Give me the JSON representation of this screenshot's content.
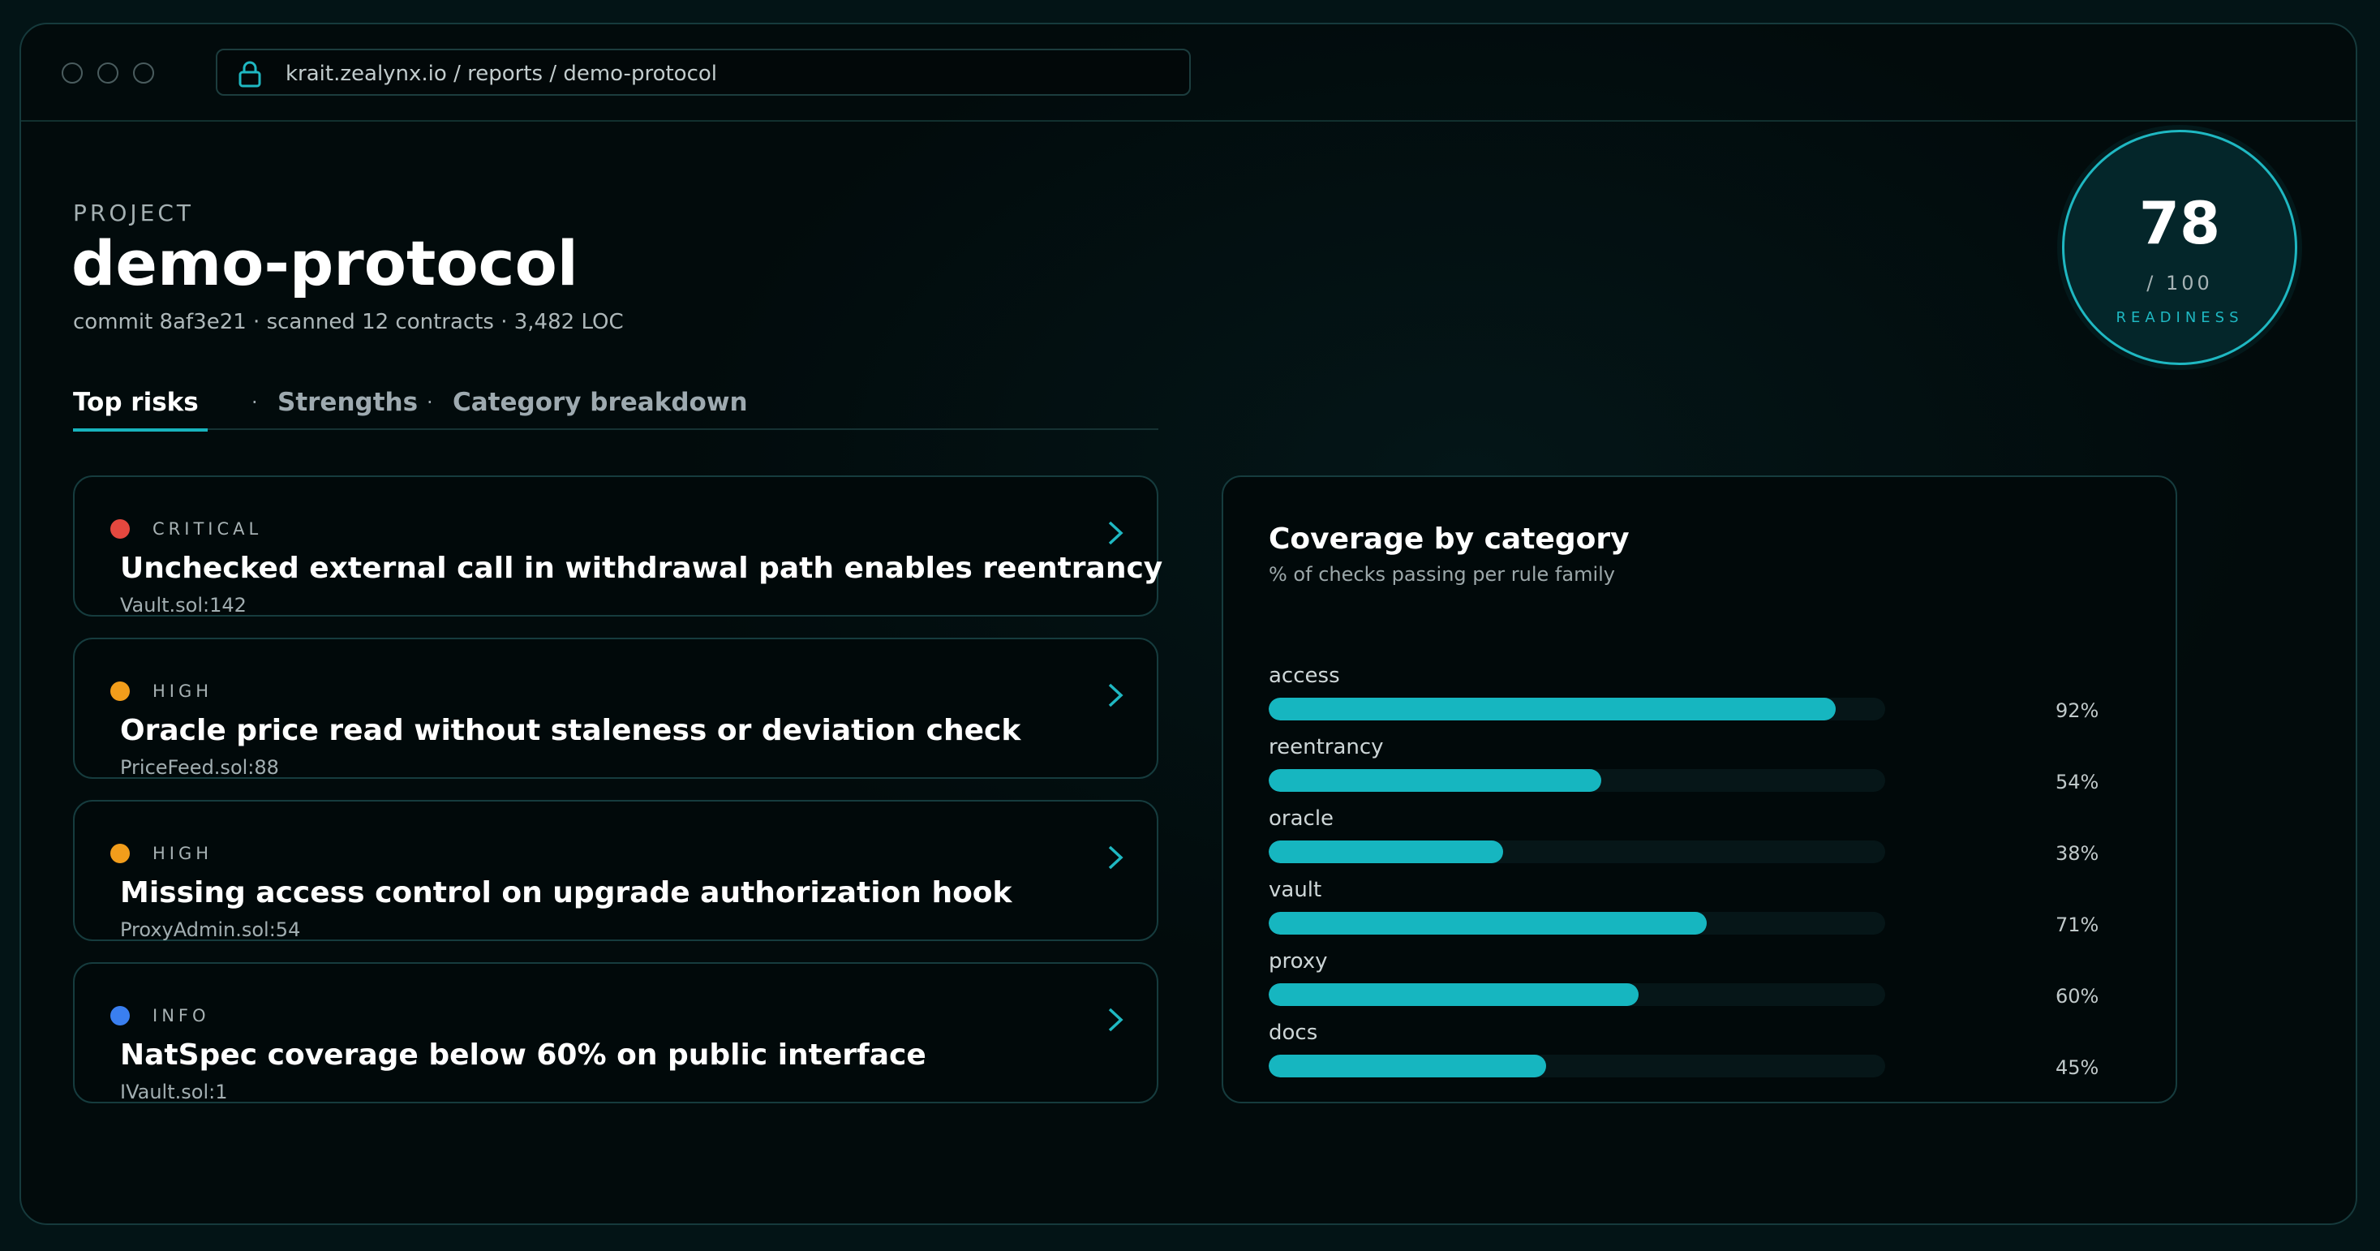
{
  "browser": {
    "url": "krait.zealynx.io / reports / demo-protocol"
  },
  "project": {
    "label": "PROJECT",
    "name": "demo-protocol",
    "meta": "commit 8af3e21 · scanned 12 contracts · 3,482 LOC"
  },
  "tabs": {
    "items": [
      {
        "label": "Top risks",
        "active": true
      },
      {
        "label": "Strengths",
        "active": false
      },
      {
        "label": "Category breakdown",
        "active": false
      }
    ],
    "separator": "·"
  },
  "score": {
    "value": "78",
    "max": "/ 100",
    "label": "READINESS"
  },
  "risks": [
    {
      "severity": "CRITICAL",
      "color": "#e5483f",
      "title": "Unchecked external call in withdrawal path enables reentrancy",
      "file": "Vault.sol:142"
    },
    {
      "severity": "HIGH",
      "color": "#f29d1b",
      "title": "Oracle price read without staleness or deviation check",
      "file": "PriceFeed.sol:88"
    },
    {
      "severity": "HIGH",
      "color": "#f29d1b",
      "title": "Missing access control on upgrade authorization hook",
      "file": "ProxyAdmin.sol:54"
    },
    {
      "severity": "INFO",
      "color": "#3a7ff0",
      "title": "NatSpec coverage below 60% on public interface",
      "file": "IVault.sol:1"
    }
  ],
  "coverage": {
    "title": "Coverage by category",
    "subtitle": "% of checks passing per rule family",
    "rows": [
      {
        "label": "access",
        "value": 92,
        "pct": "92%"
      },
      {
        "label": "reentrancy",
        "value": 54,
        "pct": "54%"
      },
      {
        "label": "oracle",
        "value": 38,
        "pct": "38%"
      },
      {
        "label": "vault",
        "value": 71,
        "pct": "71%"
      },
      {
        "label": "proxy",
        "value": 60,
        "pct": "60%"
      },
      {
        "label": "docs",
        "value": 45,
        "pct": "45%"
      }
    ]
  },
  "colors": {
    "accent": "#16b6c0",
    "critical": "#e5483f",
    "high": "#f29d1b",
    "info": "#3a7ff0"
  }
}
